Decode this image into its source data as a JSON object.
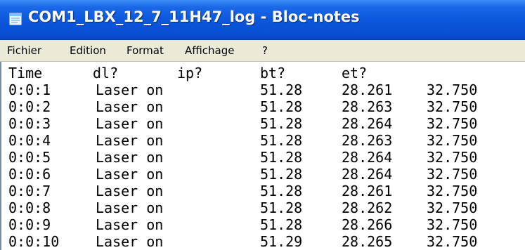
{
  "window": {
    "title": "COM1_LBX_12_7_11H47_log - Bloc-notes",
    "icon": "notepad-icon",
    "titlebar_color": "#0b56dc"
  },
  "menu": {
    "items": [
      "Fichier",
      "Edition",
      "Format",
      "Affichage",
      "?"
    ]
  },
  "table": {
    "headers": [
      "Time",
      "dl?",
      "ip?",
      "bt?",
      "et?"
    ],
    "rows": [
      [
        "0:0:1",
        "Laser on",
        "51.28",
        "28.261",
        "32.750"
      ],
      [
        "0:0:2",
        "Laser on",
        "51.28",
        "28.263",
        "32.750"
      ],
      [
        "0:0:3",
        "Laser on",
        "51.28",
        "28.264",
        "32.750"
      ],
      [
        "0:0:4",
        "Laser on",
        "51.28",
        "28.263",
        "32.750"
      ],
      [
        "0:0:5",
        "Laser on",
        "51.28",
        "28.264",
        "32.750"
      ],
      [
        "0:0:6",
        "Laser on",
        "51.28",
        "28.264",
        "32.750"
      ],
      [
        "0:0:7",
        "Laser on",
        "51.28",
        "28.261",
        "32.750"
      ],
      [
        "0:0:8",
        "Laser on",
        "51.28",
        "28.262",
        "32.750"
      ],
      [
        "0:0:9",
        "Laser on",
        "51.28",
        "28.266",
        "32.750"
      ],
      [
        "0:0:10",
        "Laser on",
        "51.29",
        "28.265",
        "32.750"
      ]
    ]
  }
}
